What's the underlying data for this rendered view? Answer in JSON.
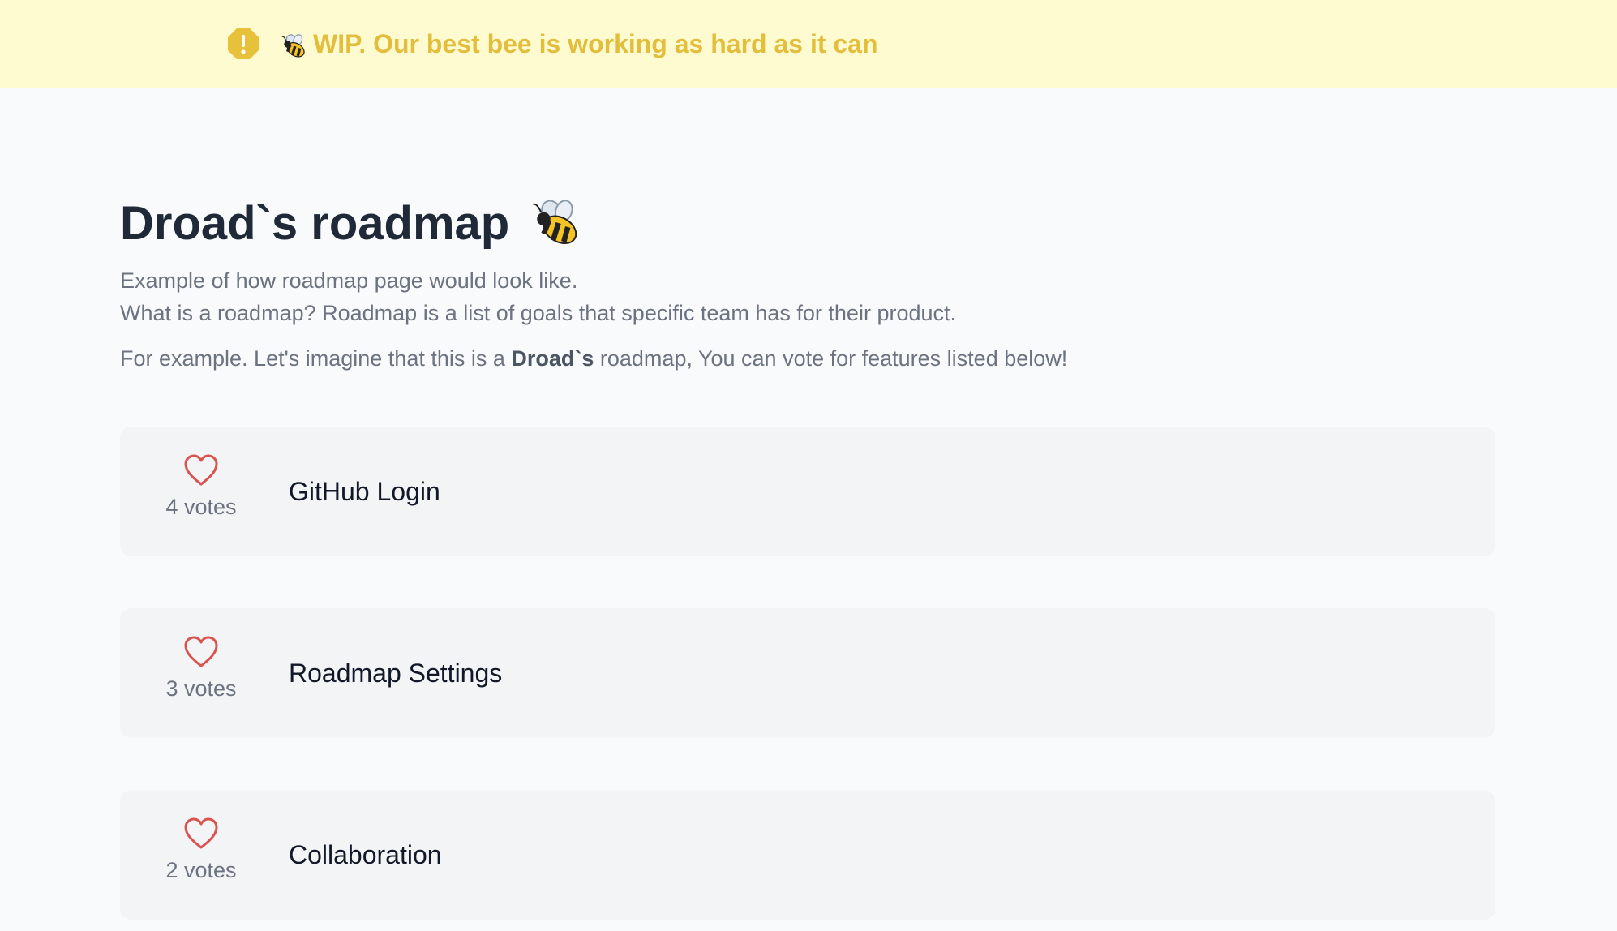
{
  "banner": {
    "icon": "exclamation-octagon-icon",
    "text": "WIP. Our best bee is working as hard as it can",
    "background": "#fefbd0",
    "color": "#e3bd3c"
  },
  "page": {
    "title": "Droad`s roadmap",
    "desc_line1": "Example of how roadmap page would look like.",
    "desc_line2": "What is a roadmap? Roadmap is a list of goals that specific team has for their product.",
    "desc_line3_prefix": "For example. Let's imagine that this is a ",
    "desc_line3_bold": "Droad`s",
    "desc_line3_suffix": " roadmap, You can vote for features listed below!"
  },
  "features": [
    {
      "votes_label": "4 votes",
      "title": "GitHub Login"
    },
    {
      "votes_label": "3 votes",
      "title": "Roadmap Settings"
    },
    {
      "votes_label": "2 votes",
      "title": "Collaboration"
    }
  ],
  "colors": {
    "heart": "#d9534f",
    "card": "#f3f4f6",
    "page_bg": "#f9fafb"
  }
}
